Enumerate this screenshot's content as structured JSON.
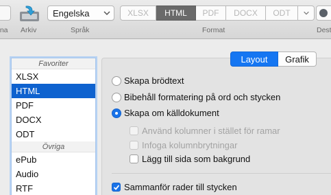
{
  "toolbar": {
    "open_label": "nna",
    "save_label": "Arkiv",
    "language_label": "Språk",
    "language_value": "Engelska",
    "format_label": "Format",
    "format_options": [
      "XLSX",
      "HTML",
      "PDF",
      "DOCX",
      "ODT"
    ],
    "selected_format": "HTML",
    "dest_label": "Dest"
  },
  "sidebar": {
    "favorites_header": "Favoriter",
    "favorites": [
      "XLSX",
      "HTML",
      "PDF",
      "DOCX",
      "ODT"
    ],
    "other_header": "Övriga",
    "other": [
      "ePub",
      "Audio",
      "RTF"
    ],
    "selected": "HTML"
  },
  "tabs": {
    "layout": "Layout",
    "grafik": "Grafik",
    "active": "Layout"
  },
  "options": {
    "radio_plain": "Skapa brödtext",
    "radio_keep": "Bibehåll formatering på ord och stycken",
    "radio_source": "Skapa om källdokument",
    "check_columns": "Använd kolumner i stället för ramar",
    "check_breaks": "Infoga kolumnbrytningar",
    "check_background": "Lägg till sida som bakgrund",
    "check_merge": "Sammanför rader till stycken"
  },
  "colors": {
    "accent": "#1576f2",
    "selection": "#0e62cf",
    "segment_selected": "#6a6a6a"
  }
}
